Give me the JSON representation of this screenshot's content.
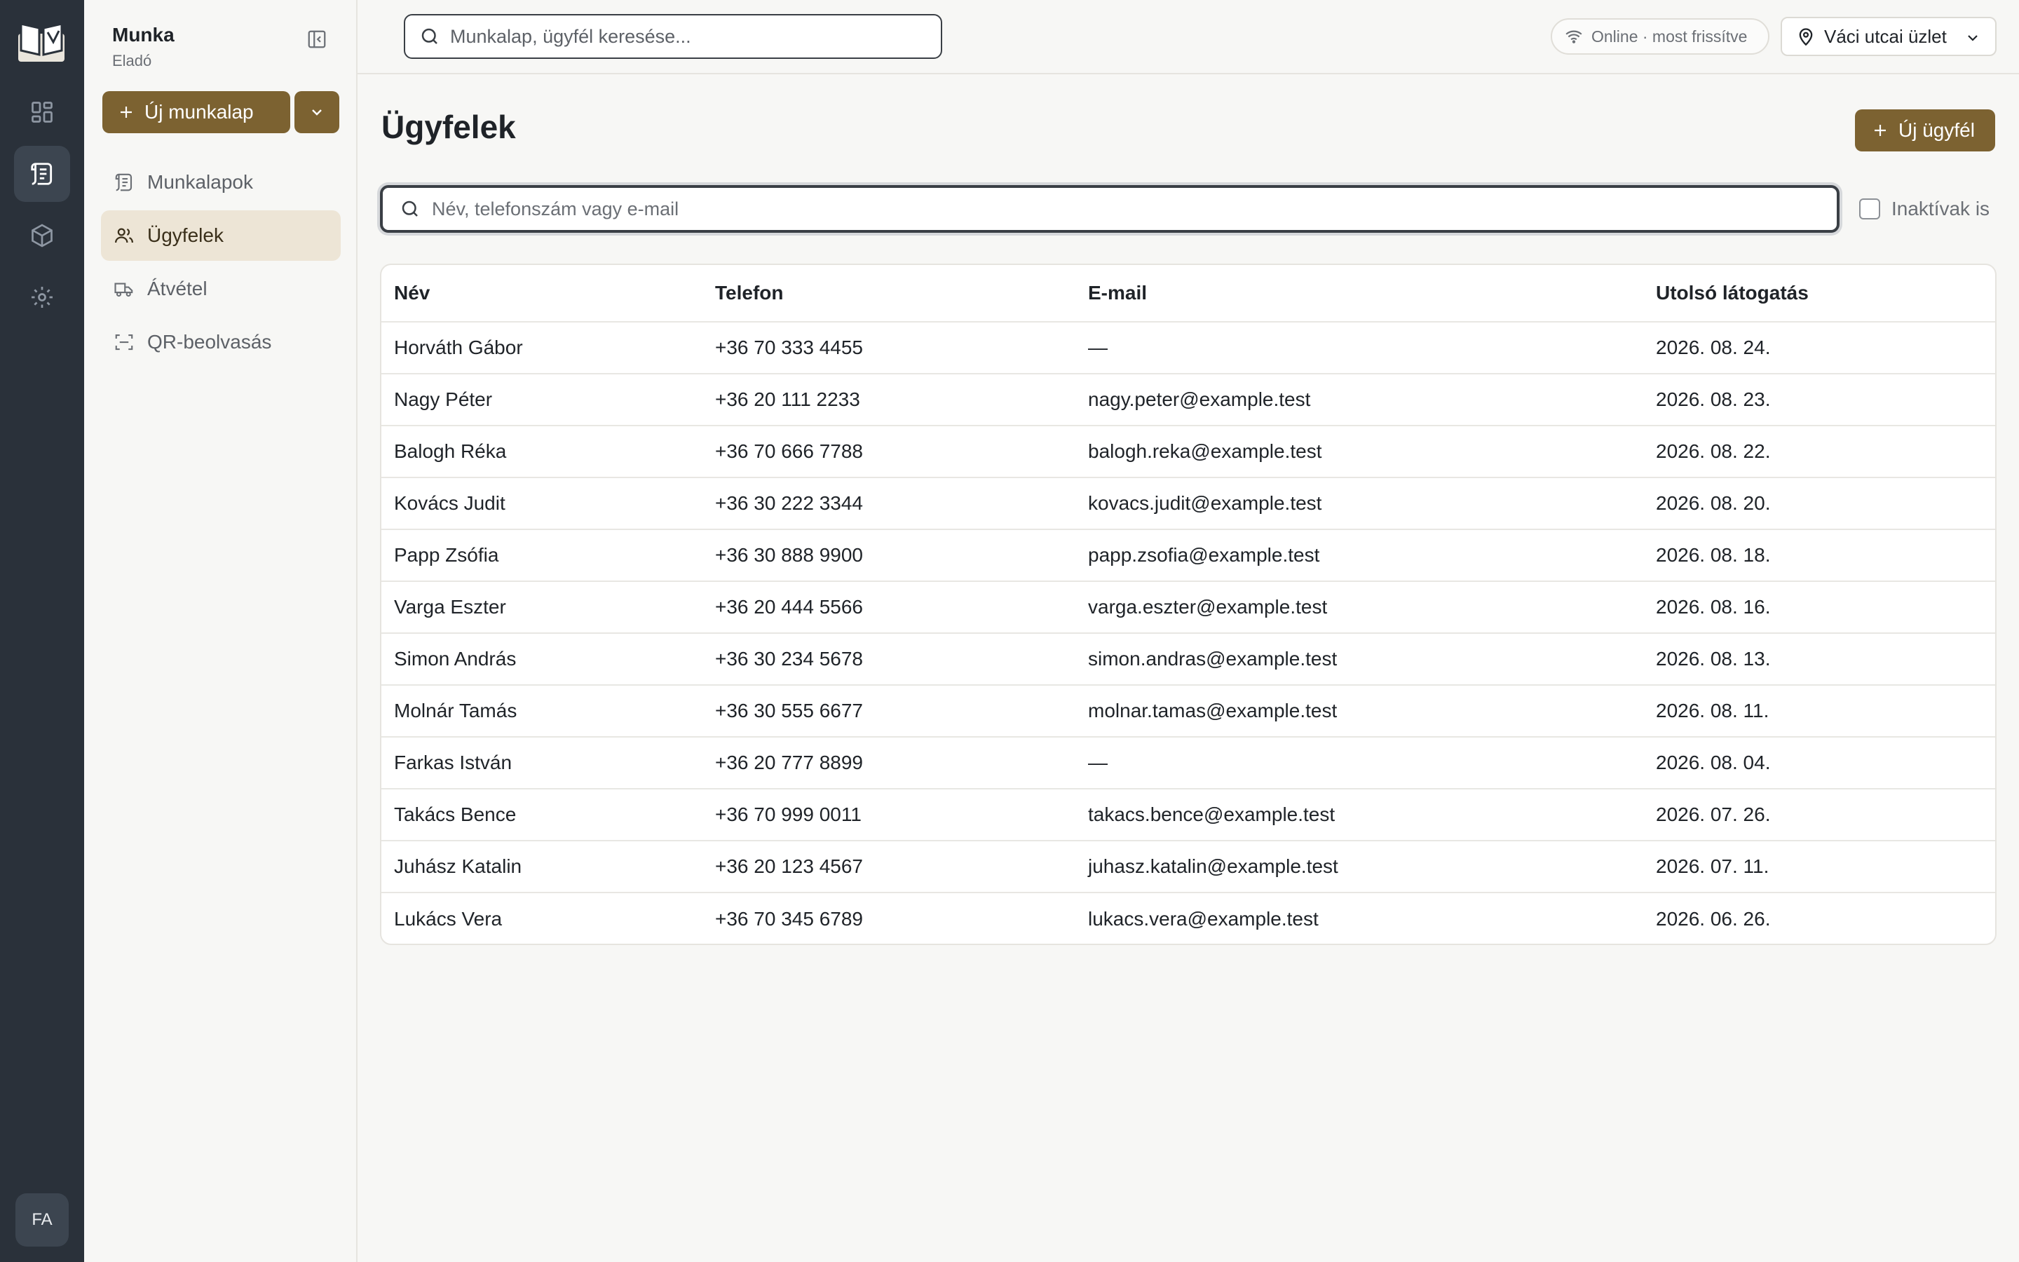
{
  "app": {
    "name": "Munka",
    "role": "Eladó",
    "user_initials": "FA"
  },
  "sidebar": {
    "new_worksheet_label": "Új munkalap",
    "items": [
      {
        "label": "Munkalapok",
        "icon": "worksheet-icon"
      },
      {
        "label": "Ügyfelek",
        "icon": "users-icon",
        "active": true
      },
      {
        "label": "Átvétel",
        "icon": "truck-icon"
      },
      {
        "label": "QR-beolvasás",
        "icon": "qr-scan-icon"
      }
    ]
  },
  "topbar": {
    "search_placeholder": "Munkalap, ügyfél keresése...",
    "status": "Online · most frissítve",
    "store": "Váci utcai üzlet"
  },
  "page": {
    "title": "Ügyfelek",
    "new_client_label": "Új ügyfél",
    "filter_placeholder": "Név, telefonszám vagy e-mail",
    "inactive_label": "Inaktívak is"
  },
  "table": {
    "headers": [
      "Név",
      "Telefon",
      "E-mail",
      "Utolsó látogatás"
    ],
    "rows": [
      [
        "Horváth Gábor",
        "+36 70 333 4455",
        "—",
        "2026. 08. 24."
      ],
      [
        "Nagy Péter",
        "+36 20 111 2233",
        "nagy.peter@example.test",
        "2026. 08. 23."
      ],
      [
        "Balogh Réka",
        "+36 70 666 7788",
        "balogh.reka@example.test",
        "2026. 08. 22."
      ],
      [
        "Kovács Judit",
        "+36 30 222 3344",
        "kovacs.judit@example.test",
        "2026. 08. 20."
      ],
      [
        "Papp Zsófia",
        "+36 30 888 9900",
        "papp.zsofia@example.test",
        "2026. 08. 18."
      ],
      [
        "Varga Eszter",
        "+36 20 444 5566",
        "varga.eszter@example.test",
        "2026. 08. 16."
      ],
      [
        "Simon András",
        "+36 30 234 5678",
        "simon.andras@example.test",
        "2026. 08. 13."
      ],
      [
        "Molnár Tamás",
        "+36 30 555 6677",
        "molnar.tamas@example.test",
        "2026. 08. 11."
      ],
      [
        "Farkas István",
        "+36 20 777 8899",
        "—",
        "2026. 08. 04."
      ],
      [
        "Takács Bence",
        "+36 70 999 0011",
        "takacs.bence@example.test",
        "2026. 07. 26."
      ],
      [
        "Juhász Katalin",
        "+36 20 123 4567",
        "juhasz.katalin@example.test",
        "2026. 07. 11."
      ],
      [
        "Lukács Vera",
        "+36 70 345 6789",
        "lukacs.vera@example.test",
        "2026. 06. 26."
      ]
    ]
  },
  "colors": {
    "accent": "#7c6231",
    "rail": "#2a313a",
    "active_nav": "#ede5d6"
  }
}
